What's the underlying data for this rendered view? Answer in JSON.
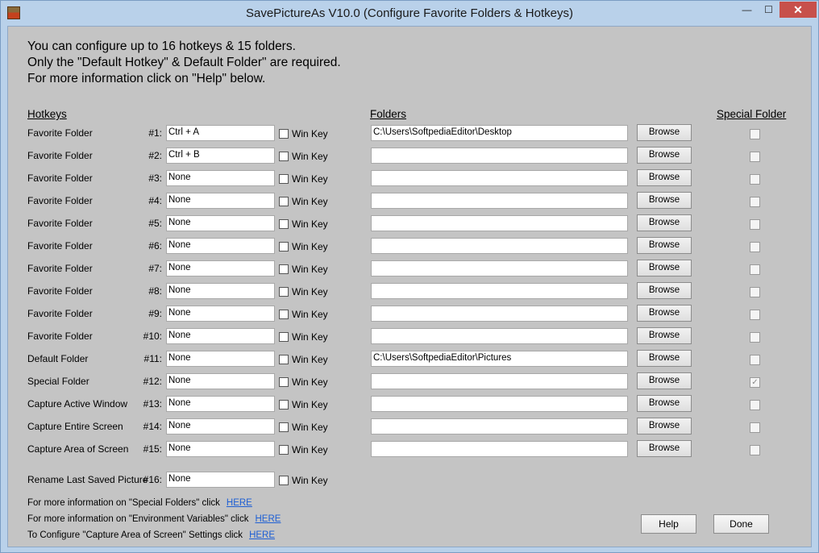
{
  "window": {
    "title": "SavePictureAs V10.0 (Configure Favorite Folders & Hotkeys)",
    "minimize_glyph": "—",
    "maximize_glyph": "☐",
    "close_glyph": "✕"
  },
  "intro": {
    "line1": "You can configure up to 16 hotkeys & 15 folders.",
    "line2": "Only the \"Default Hotkey\" & Default Folder\" are required.",
    "line3": "For more information click on \"Help\" below."
  },
  "headers": {
    "hotkeys": "Hotkeys",
    "folders": "Folders",
    "special_folder": "Special Folder"
  },
  "win_key_label": "Win Key",
  "browse_label": "Browse",
  "rows": [
    {
      "label": "Favorite Folder",
      "num": "#1:",
      "hotkey": "Ctrl + A",
      "win": false,
      "folder": "C:\\Users\\SoftpediaEditor\\Desktop",
      "special": false
    },
    {
      "label": "Favorite Folder",
      "num": "#2:",
      "hotkey": "Ctrl + B",
      "win": false,
      "folder": "",
      "special": false
    },
    {
      "label": "Favorite Folder",
      "num": "#3:",
      "hotkey": "None",
      "win": false,
      "folder": "",
      "special": false
    },
    {
      "label": "Favorite Folder",
      "num": "#4:",
      "hotkey": "None",
      "win": false,
      "folder": "",
      "special": false
    },
    {
      "label": "Favorite Folder",
      "num": "#5:",
      "hotkey": "None",
      "win": false,
      "folder": "",
      "special": false
    },
    {
      "label": "Favorite Folder",
      "num": "#6:",
      "hotkey": "None",
      "win": false,
      "folder": "",
      "special": false
    },
    {
      "label": "Favorite Folder",
      "num": "#7:",
      "hotkey": "None",
      "win": false,
      "folder": "",
      "special": false
    },
    {
      "label": "Favorite Folder",
      "num": "#8:",
      "hotkey": "None",
      "win": false,
      "folder": "",
      "special": false
    },
    {
      "label": "Favorite Folder",
      "num": "#9:",
      "hotkey": "None",
      "win": false,
      "folder": "",
      "special": false
    },
    {
      "label": "Favorite Folder",
      "num": "#10:",
      "hotkey": "None",
      "win": false,
      "folder": "",
      "special": false
    },
    {
      "label": "Default Folder",
      "num": "#11:",
      "hotkey": "None",
      "win": false,
      "folder": "C:\\Users\\SoftpediaEditor\\Pictures",
      "special": false
    },
    {
      "label": "Special Folder",
      "num": "#12:",
      "hotkey": "None",
      "win": false,
      "folder": "",
      "special": true
    },
    {
      "label": "Capture Active Window",
      "num": "#13:",
      "hotkey": "None",
      "win": false,
      "folder": "",
      "special": false
    },
    {
      "label": "Capture Entire Screen",
      "num": "#14:",
      "hotkey": "None",
      "win": false,
      "folder": "",
      "special": false
    },
    {
      "label": "Capture Area of Screen",
      "num": "#15:",
      "hotkey": "None",
      "win": false,
      "folder": "",
      "special": false
    }
  ],
  "rename_row": {
    "label": "Rename Last Saved Picture",
    "num": "#16:",
    "hotkey": "None",
    "win": false
  },
  "info_links": [
    {
      "text": "For more information on \"Special Folders\" click",
      "link": "HERE"
    },
    {
      "text": "For more information on \"Environment Variables\" click",
      "link": "HERE"
    },
    {
      "text": "To Configure \"Capture Area of Screen\" Settings click",
      "link": "HERE"
    }
  ],
  "buttons": {
    "help": "Help",
    "done": "Done"
  },
  "check_glyph": "✓"
}
